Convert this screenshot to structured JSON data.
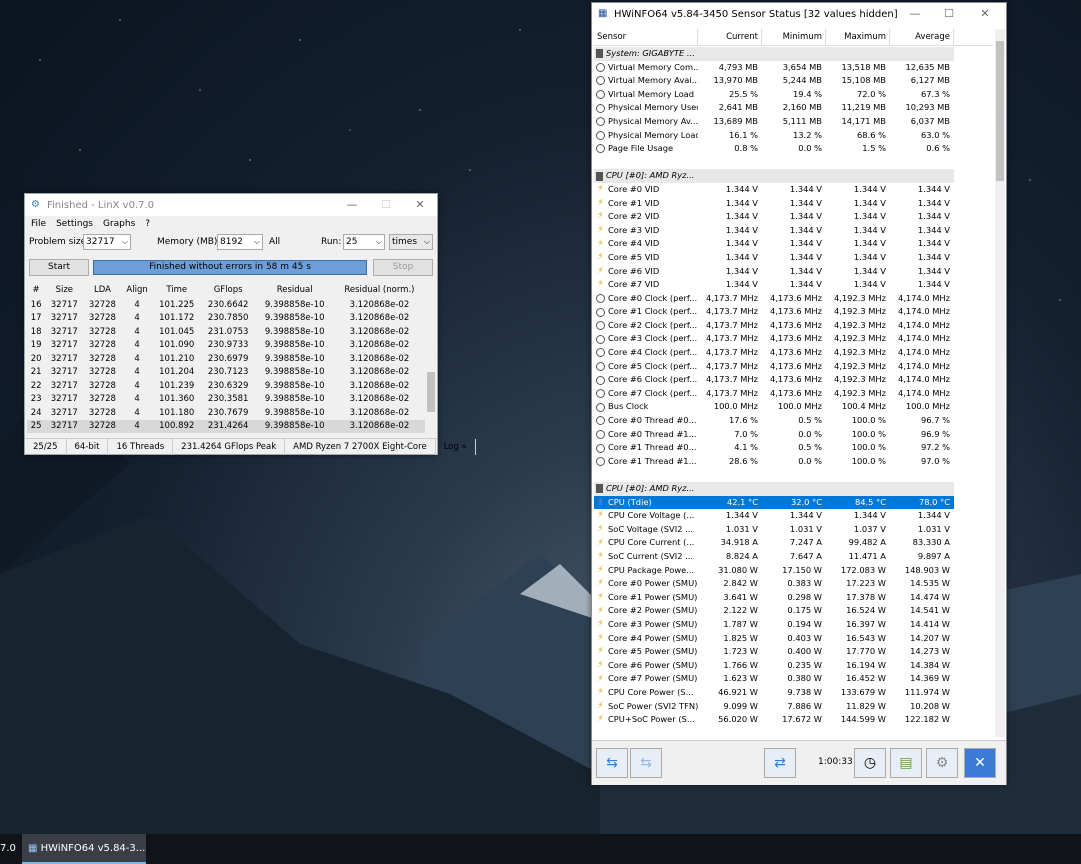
{
  "linx": {
    "title": "Finished - LinX v0.7.0",
    "menu": [
      "File",
      "Settings",
      "Graphs",
      "?"
    ],
    "problem_size_label": "Problem size:",
    "problem_size": "32717",
    "memory_label": "Memory (MB):",
    "memory": "8192",
    "all_label": "All",
    "run_label": "Run:",
    "run": "25",
    "run_unit": "times",
    "start_label": "Start",
    "stop_label": "Stop",
    "progress_text": "Finished without errors in 58 m 45 s",
    "columns": [
      "#",
      "Size",
      "LDA",
      "Align",
      "Time",
      "GFlops",
      "Residual",
      "Residual (norm.)"
    ],
    "rows": [
      [
        "16",
        "32717",
        "32728",
        "4",
        "101.225",
        "230.6642",
        "9.398858e-10",
        "3.120868e-02"
      ],
      [
        "17",
        "32717",
        "32728",
        "4",
        "101.172",
        "230.7850",
        "9.398858e-10",
        "3.120868e-02"
      ],
      [
        "18",
        "32717",
        "32728",
        "4",
        "101.045",
        "231.0753",
        "9.398858e-10",
        "3.120868e-02"
      ],
      [
        "19",
        "32717",
        "32728",
        "4",
        "101.090",
        "230.9733",
        "9.398858e-10",
        "3.120868e-02"
      ],
      [
        "20",
        "32717",
        "32728",
        "4",
        "101.210",
        "230.6979",
        "9.398858e-10",
        "3.120868e-02"
      ],
      [
        "21",
        "32717",
        "32728",
        "4",
        "101.204",
        "230.7123",
        "9.398858e-10",
        "3.120868e-02"
      ],
      [
        "22",
        "32717",
        "32728",
        "4",
        "101.239",
        "230.6329",
        "9.398858e-10",
        "3.120868e-02"
      ],
      [
        "23",
        "32717",
        "32728",
        "4",
        "101.360",
        "230.3581",
        "9.398858e-10",
        "3.120868e-02"
      ],
      [
        "24",
        "32717",
        "32728",
        "4",
        "101.180",
        "230.7679",
        "9.398858e-10",
        "3.120868e-02"
      ],
      [
        "25",
        "32717",
        "32728",
        "4",
        "100.892",
        "231.4264",
        "9.398858e-10",
        "3.120868e-02"
      ]
    ],
    "status": [
      "25/25",
      "64-bit",
      "16 Threads",
      "231.4264 GFlops Peak",
      "AMD Ryzen 7 2700X Eight-Core",
      "Log »"
    ]
  },
  "hwinfo": {
    "title": "HWiNFO64 v5.84-3450 Sensor Status [32 values hidden]",
    "columns": [
      "Sensor",
      "Current",
      "Minimum",
      "Maximum",
      "Average"
    ],
    "rows": [
      {
        "t": "grp",
        "name": "System: GIGABYTE ..."
      },
      {
        "t": "clock",
        "name": "Virtual Memory Com...",
        "v": [
          "4,793 MB",
          "3,654 MB",
          "13,518 MB",
          "12,635 MB"
        ]
      },
      {
        "t": "clock",
        "name": "Virtual Memory Avai...",
        "v": [
          "13,970 MB",
          "5,244 MB",
          "15,108 MB",
          "6,127 MB"
        ]
      },
      {
        "t": "clock",
        "name": "Virtual Memory Load",
        "v": [
          "25.5 %",
          "19.4 %",
          "72.0 %",
          "67.3 %"
        ]
      },
      {
        "t": "clock",
        "name": "Physical Memory Used",
        "v": [
          "2,641 MB",
          "2,160 MB",
          "11,219 MB",
          "10,293 MB"
        ]
      },
      {
        "t": "clock",
        "name": "Physical Memory Av...",
        "v": [
          "13,689 MB",
          "5,111 MB",
          "14,171 MB",
          "6,037 MB"
        ]
      },
      {
        "t": "clock",
        "name": "Physical Memory Load",
        "v": [
          "16.1 %",
          "13.2 %",
          "68.6 %",
          "63.0 %"
        ]
      },
      {
        "t": "clock",
        "name": "Page File Usage",
        "v": [
          "0.8 %",
          "0.0 %",
          "1.5 %",
          "0.6 %"
        ]
      },
      {
        "t": "blank"
      },
      {
        "t": "grp",
        "name": "CPU [#0]: AMD Ryz..."
      },
      {
        "t": "volt",
        "name": "Core #0 VID",
        "v": [
          "1.344 V",
          "1.344 V",
          "1.344 V",
          "1.344 V"
        ]
      },
      {
        "t": "volt",
        "name": "Core #1 VID",
        "v": [
          "1.344 V",
          "1.344 V",
          "1.344 V",
          "1.344 V"
        ]
      },
      {
        "t": "volt",
        "name": "Core #2 VID",
        "v": [
          "1.344 V",
          "1.344 V",
          "1.344 V",
          "1.344 V"
        ]
      },
      {
        "t": "volt",
        "name": "Core #3 VID",
        "v": [
          "1.344 V",
          "1.344 V",
          "1.344 V",
          "1.344 V"
        ]
      },
      {
        "t": "volt",
        "name": "Core #4 VID",
        "v": [
          "1.344 V",
          "1.344 V",
          "1.344 V",
          "1.344 V"
        ]
      },
      {
        "t": "volt",
        "name": "Core #5 VID",
        "v": [
          "1.344 V",
          "1.344 V",
          "1.344 V",
          "1.344 V"
        ]
      },
      {
        "t": "volt",
        "name": "Core #6 VID",
        "v": [
          "1.344 V",
          "1.344 V",
          "1.344 V",
          "1.344 V"
        ]
      },
      {
        "t": "volt",
        "name": "Core #7 VID",
        "v": [
          "1.344 V",
          "1.344 V",
          "1.344 V",
          "1.344 V"
        ]
      },
      {
        "t": "clock",
        "name": "Core #0 Clock (perf...",
        "v": [
          "4,173.7 MHz",
          "4,173.6 MHz",
          "4,192.3 MHz",
          "4,174.0 MHz"
        ]
      },
      {
        "t": "clock",
        "name": "Core #1 Clock (perf...",
        "v": [
          "4,173.7 MHz",
          "4,173.6 MHz",
          "4,192.3 MHz",
          "4,174.0 MHz"
        ]
      },
      {
        "t": "clock",
        "name": "Core #2 Clock (perf...",
        "v": [
          "4,173.7 MHz",
          "4,173.6 MHz",
          "4,192.3 MHz",
          "4,174.0 MHz"
        ]
      },
      {
        "t": "clock",
        "name": "Core #3 Clock (perf...",
        "v": [
          "4,173.7 MHz",
          "4,173.6 MHz",
          "4,192.3 MHz",
          "4,174.0 MHz"
        ]
      },
      {
        "t": "clock",
        "name": "Core #4 Clock (perf...",
        "v": [
          "4,173.7 MHz",
          "4,173.6 MHz",
          "4,192.3 MHz",
          "4,174.0 MHz"
        ]
      },
      {
        "t": "clock",
        "name": "Core #5 Clock (perf...",
        "v": [
          "4,173.7 MHz",
          "4,173.6 MHz",
          "4,192.3 MHz",
          "4,174.0 MHz"
        ]
      },
      {
        "t": "clock",
        "name": "Core #6 Clock (perf...",
        "v": [
          "4,173.7 MHz",
          "4,173.6 MHz",
          "4,192.3 MHz",
          "4,174.0 MHz"
        ]
      },
      {
        "t": "clock",
        "name": "Core #7 Clock (perf...",
        "v": [
          "4,173.7 MHz",
          "4,173.6 MHz",
          "4,192.3 MHz",
          "4,174.0 MHz"
        ]
      },
      {
        "t": "clock",
        "name": "Bus Clock",
        "v": [
          "100.0 MHz",
          "100.0 MHz",
          "100.4 MHz",
          "100.0 MHz"
        ]
      },
      {
        "t": "clock",
        "name": "Core #0 Thread #0...",
        "v": [
          "17.6 %",
          "0.5 %",
          "100.0 %",
          "96.7 %"
        ]
      },
      {
        "t": "clock",
        "name": "Core #0 Thread #1...",
        "v": [
          "7.0 %",
          "0.0 %",
          "100.0 %",
          "96.9 %"
        ]
      },
      {
        "t": "clock",
        "name": "Core #1 Thread #0...",
        "v": [
          "4.1 %",
          "0.5 %",
          "100.0 %",
          "97.2 %"
        ]
      },
      {
        "t": "clock",
        "name": "Core #1 Thread #1...",
        "v": [
          "28.6 %",
          "0.0 %",
          "100.0 %",
          "97.0 %"
        ]
      },
      {
        "t": "blank"
      },
      {
        "t": "grp",
        "name": "CPU [#0]: AMD Ryz..."
      },
      {
        "t": "therm",
        "name": "CPU (Tdie)",
        "v": [
          "42.1 °C",
          "32.0 °C",
          "84.5 °C",
          "78.0 °C"
        ],
        "sel": true
      },
      {
        "t": "volt",
        "name": "CPU Core Voltage (...",
        "v": [
          "1.344 V",
          "1.344 V",
          "1.344 V",
          "1.344 V"
        ]
      },
      {
        "t": "volt",
        "name": "SoC Voltage (SVI2 ...",
        "v": [
          "1.031 V",
          "1.031 V",
          "1.037 V",
          "1.031 V"
        ]
      },
      {
        "t": "volt",
        "name": "CPU Core Current (...",
        "v": [
          "34.918 A",
          "7.247 A",
          "99.482 A",
          "83.330 A"
        ]
      },
      {
        "t": "volt",
        "name": "SoC Current (SVI2 ...",
        "v": [
          "8.824 A",
          "7.647 A",
          "11.471 A",
          "9.897 A"
        ]
      },
      {
        "t": "volt",
        "name": "CPU Package Powe...",
        "v": [
          "31.080 W",
          "17.150 W",
          "172.083 W",
          "148.903 W"
        ]
      },
      {
        "t": "volt",
        "name": "Core #0 Power (SMU)",
        "v": [
          "2.842 W",
          "0.383 W",
          "17.223 W",
          "14.535 W"
        ]
      },
      {
        "t": "volt",
        "name": "Core #1 Power (SMU)",
        "v": [
          "3.641 W",
          "0.298 W",
          "17.378 W",
          "14.474 W"
        ]
      },
      {
        "t": "volt",
        "name": "Core #2 Power (SMU)",
        "v": [
          "2.122 W",
          "0.175 W",
          "16.524 W",
          "14.541 W"
        ]
      },
      {
        "t": "volt",
        "name": "Core #3 Power (SMU)",
        "v": [
          "1.787 W",
          "0.194 W",
          "16.397 W",
          "14.414 W"
        ]
      },
      {
        "t": "volt",
        "name": "Core #4 Power (SMU)",
        "v": [
          "1.825 W",
          "0.403 W",
          "16.543 W",
          "14.207 W"
        ]
      },
      {
        "t": "volt",
        "name": "Core #5 Power (SMU)",
        "v": [
          "1.723 W",
          "0.400 W",
          "17.770 W",
          "14.273 W"
        ]
      },
      {
        "t": "volt",
        "name": "Core #6 Power (SMU)",
        "v": [
          "1.766 W",
          "0.235 W",
          "16.194 W",
          "14.384 W"
        ]
      },
      {
        "t": "volt",
        "name": "Core #7 Power (SMU)",
        "v": [
          "1.623 W",
          "0.380 W",
          "16.452 W",
          "14.369 W"
        ]
      },
      {
        "t": "volt",
        "name": "CPU Core Power (S...",
        "v": [
          "46.921 W",
          "9.738 W",
          "133.679 W",
          "111.974 W"
        ]
      },
      {
        "t": "volt",
        "name": "SoC Power (SVI2 TFN)",
        "v": [
          "9.099 W",
          "7.886 W",
          "11.829 W",
          "10.208 W"
        ]
      },
      {
        "t": "volt",
        "name": "CPU+SoC Power (S...",
        "v": [
          "56.020 W",
          "17.672 W",
          "144.599 W",
          "122.182 W"
        ]
      }
    ],
    "elapsed": "1:00:33"
  },
  "taskbar": {
    "left_fragment": "7.0",
    "hwinfo_task": "HWiNFO64 v5.84-3..."
  },
  "colors": {
    "accent": "#0078d7",
    "progress": "#6e9ed8"
  }
}
